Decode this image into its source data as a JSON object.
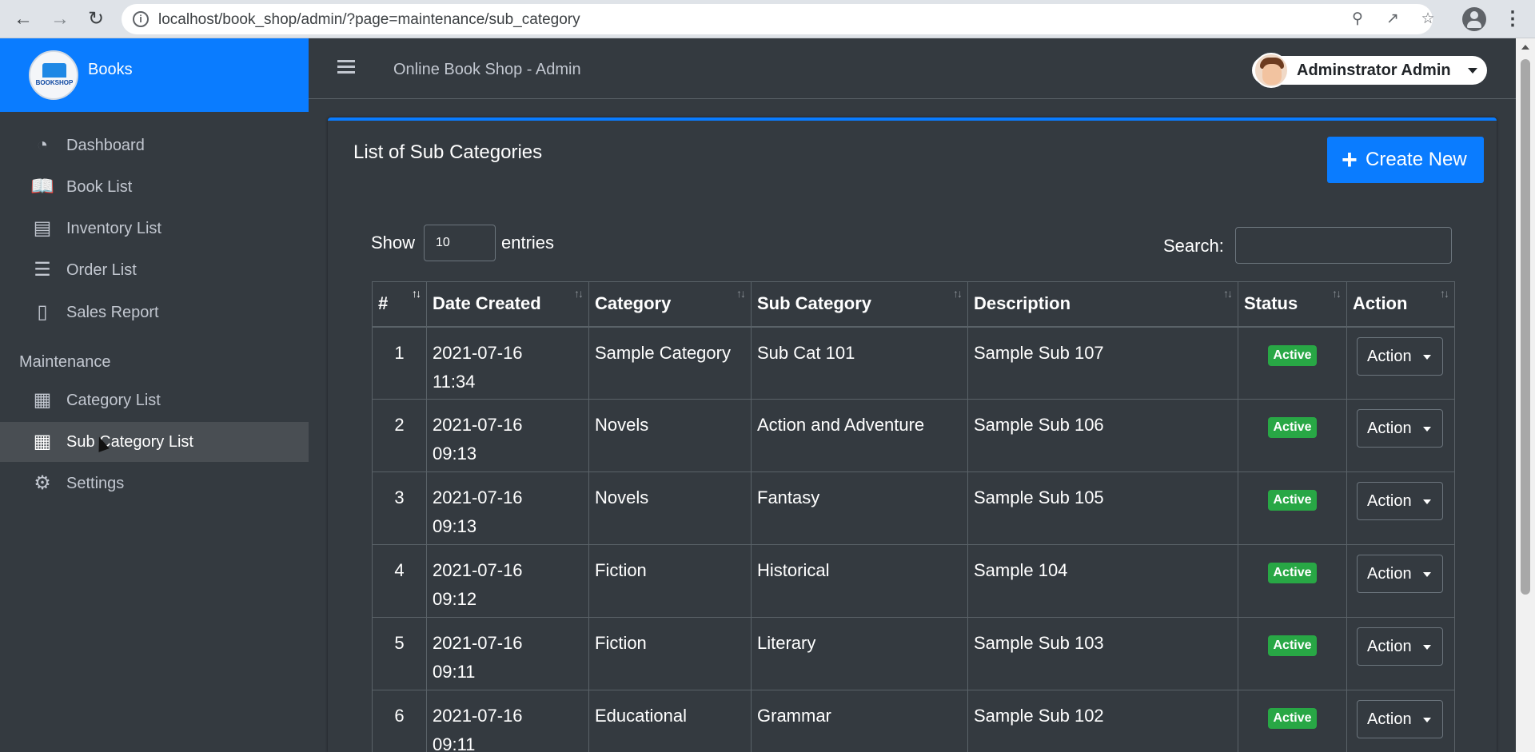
{
  "browser": {
    "url": "localhost/book_shop/admin/?page=maintenance/sub_category",
    "icons": [
      "back-icon",
      "forward-icon",
      "reload-icon",
      "zoom-icon",
      "share-icon",
      "star-icon",
      "profile-icon",
      "kebab-icon"
    ]
  },
  "sidebar": {
    "brand": "Books",
    "logo_text": "BOOKSHOP",
    "items": [
      {
        "label": "Dashboard",
        "icon": "dashboard-icon"
      },
      {
        "label": "Book List",
        "icon": "book-icon"
      },
      {
        "label": "Inventory List",
        "icon": "clipboard-icon"
      },
      {
        "label": "Order List",
        "icon": "list-icon"
      },
      {
        "label": "Sales Report",
        "icon": "file-icon"
      }
    ],
    "maintenance_header": "Maintenance",
    "maintenance_items": [
      {
        "label": "Category List",
        "icon": "table-icon"
      },
      {
        "label": "Sub Category List",
        "icon": "table-icon",
        "active": true
      },
      {
        "label": "Settings",
        "icon": "gears-icon"
      }
    ]
  },
  "topbar": {
    "title": "Online Book Shop - Admin",
    "user": "Adminstrator Admin"
  },
  "card": {
    "title": "List of Sub Categories",
    "create_label": "Create New"
  },
  "datatable": {
    "show_label": "Show",
    "page_size": "10",
    "entries_label": "entries",
    "search_label": "Search:",
    "columns": [
      "#",
      "Date Created",
      "Category",
      "Sub Category",
      "Description",
      "Status",
      "Action"
    ],
    "rows": [
      {
        "num": "1",
        "date": "2021-07-16",
        "time": "11:34",
        "category": "Sample Category",
        "sub": "Sub Cat 101",
        "desc": "Sample Sub 107",
        "status": "Active",
        "action": "Action"
      },
      {
        "num": "2",
        "date": "2021-07-16",
        "time": "09:13",
        "category": "Novels",
        "sub": "Action and Adventure",
        "desc": "Sample Sub 106",
        "status": "Active",
        "action": "Action"
      },
      {
        "num": "3",
        "date": "2021-07-16",
        "time": "09:13",
        "category": "Novels",
        "sub": "Fantasy",
        "desc": "Sample Sub 105",
        "status": "Active",
        "action": "Action"
      },
      {
        "num": "4",
        "date": "2021-07-16",
        "time": "09:12",
        "category": "Fiction",
        "sub": "Historical",
        "desc": "Sample 104",
        "status": "Active",
        "action": "Action"
      },
      {
        "num": "5",
        "date": "2021-07-16",
        "time": "09:11",
        "category": "Fiction",
        "sub": "Literary",
        "desc": "Sample Sub 103",
        "status": "Active",
        "action": "Action"
      },
      {
        "num": "6",
        "date": "2021-07-16",
        "time": "09:11",
        "category": "Educational",
        "sub": "Grammar",
        "desc": "Sample Sub 102",
        "status": "Active",
        "action": "Action"
      }
    ]
  },
  "colors": {
    "primary": "#0a7cff",
    "sidebar_bg": "#343a40",
    "active_badge": "#28a745"
  }
}
